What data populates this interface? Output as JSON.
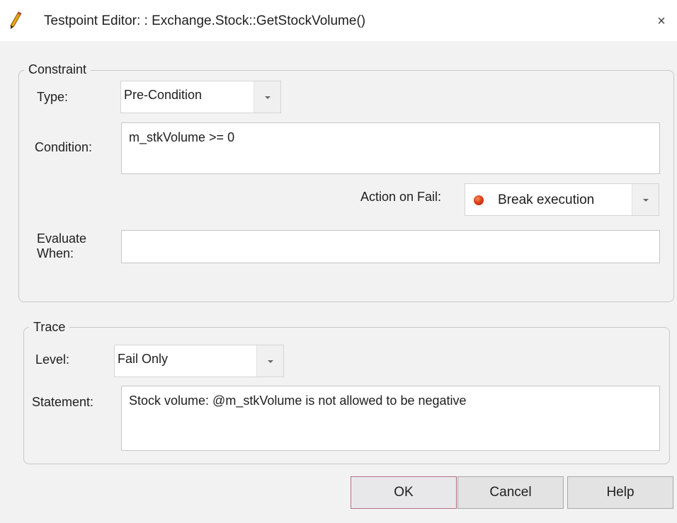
{
  "window": {
    "title": "Testpoint Editor: : Exchange.Stock::GetStockVolume()",
    "close_glyph": "×",
    "title_icon": "pencil-icon"
  },
  "constraint": {
    "legend": "Constraint",
    "type_label": "Type:",
    "type_value": "Pre-Condition",
    "condition_label": "Condition:",
    "condition_value": "m_stkVolume >= 0",
    "action_on_fail_label": "Action on Fail:",
    "action_on_fail_value": "Break execution",
    "action_on_fail_icon": "stop-icon",
    "evaluate_when_label_line1": "Evaluate",
    "evaluate_when_label_line2": "When:",
    "evaluate_when_value": ""
  },
  "trace": {
    "legend": "Trace",
    "level_label": "Level:",
    "level_value": "Fail Only",
    "statement_label": "Statement:",
    "statement_value": "Stock volume: @m_stkVolume is not allowed to be negative"
  },
  "buttons": {
    "ok": "OK",
    "cancel": "Cancel",
    "help": "Help"
  },
  "colors": {
    "dialog_background": "#f2f2f2",
    "titlebar_background": "#ffffff",
    "default_button_border": "#b5708a",
    "stop_icon": "#d9391a"
  }
}
